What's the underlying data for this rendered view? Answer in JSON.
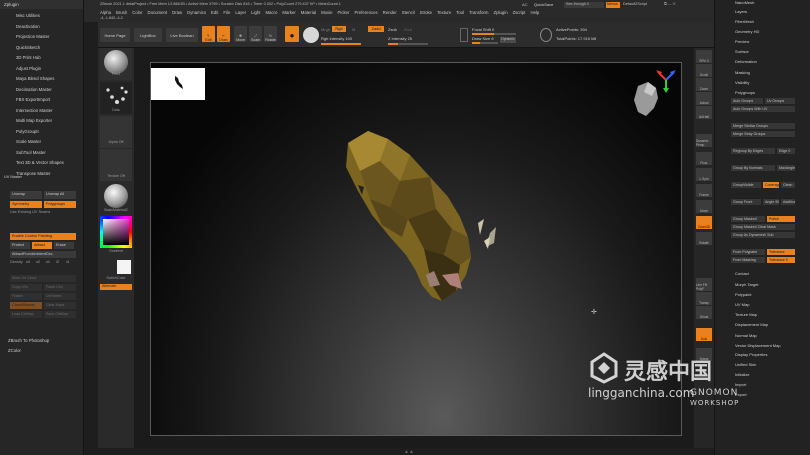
{
  "left_panel": {
    "header": "Zplugin",
    "items": [
      "Misc Utilities",
      "Deactivation",
      "Projection Master",
      "QuickSketch",
      "3D Print Hub",
      "Adjust Plugin",
      "Maya Blend Shapes",
      "Decimation Master",
      "FBX ExportImport",
      "Intersection Master",
      "Multi Map Exporter",
      "PolyGroupIt",
      "Scale Master",
      "SubTool Master",
      "Text 3D & Vector Shapes",
      "Transpose Master"
    ],
    "uv_master": {
      "title": "UV Master",
      "unwrap_label": "Unwrap",
      "unwrap_all_label": "Unwrap All",
      "symmetry_label": "Symmetry",
      "polygroups_label": "Polygroups",
      "use_existing_label": "Use Existing UV Seams",
      "enable_control_painting": "Enable Control Painting",
      "protect_label": "Protect",
      "attract_label": "Attract",
      "erase_label": "Erase",
      "attract_from_ambient": "AttractFromAmbientOcc",
      "density_label": "Density",
      "density_values": [
        "x4",
        "x2",
        "x1",
        "/2",
        "/4"
      ],
      "work_on_clone": "Work On Clone",
      "copy_uvs": "Copy UVs",
      "paste_uvs": "Paste UVs",
      "flatten": "Flatten",
      "unflatten": "UnFlatten",
      "check_seams": "CheckSeams",
      "clear_maps": "Clear Maps",
      "load_ctrl_map": "Load CtrlMap",
      "save_ctrl_map": "Save CtrlMap"
    },
    "bottom_items": [
      "ZBrush To Photoshop",
      "ZColor"
    ]
  },
  "menu_bar": {
    "title": "ZBrush 2021.1 detaiProject  • Free Mem 13.984GB • Active Mem 3799 • Scratch Disk 816 • Timer 0.002 • PolyCount 279.437 KP • MeshCount 1",
    "coords": "-4,-1.842,-4.2",
    "menus": [
      "Alpha",
      "Brush",
      "Color",
      "Document",
      "Draw",
      "Dynamics",
      "Edit",
      "File",
      "Layer",
      "Light",
      "Macro",
      "Marker",
      "Material",
      "Movie",
      "Picker",
      "Preferences",
      "Render",
      "Stencil",
      "Stroke",
      "Texture",
      "Tool",
      "Transform",
      "Zplugin",
      "Zscript",
      "Help"
    ],
    "ac_label": "AC",
    "quicksave_label": "QuickSave",
    "seethrough_label": "See-through 0",
    "menus_button": "Menus",
    "default_zscript": "DefaultZScript"
  },
  "toolbar": {
    "home_page": "Home Page",
    "lightbox": "LightBox",
    "live_boolean": "Live Boolean",
    "edit": "Edit",
    "draw": "Draw",
    "move": "Move",
    "scale": "Scale",
    "rotate": "Rotate",
    "mrgb": "Mrgb",
    "rgb": "Rgb",
    "m": "M",
    "zadd": "Zadd",
    "zsub": "Zsub",
    "zcut": "Zcut",
    "rgb_intensity": "Rgb Intensity 100",
    "z_intensity": "Z Intensity 25",
    "focal_shift": "Focal Shift 0",
    "draw_size": "Draw Size 6",
    "dynamic": "Dynamic",
    "active_points": "ActivePoints: 394",
    "total_points": "TotalPoints: 17.915 Mil"
  },
  "shelf": {
    "tiles": [
      "Pen3",
      "Dots",
      "Alpha Off",
      "Texture Off",
      "BasicMaterial2",
      "Gradient",
      "SwitchColor",
      "Alternate"
    ]
  },
  "right_shelf": {
    "buttons": [
      "SPix 3",
      "Scroll",
      "Zoom",
      "Actual",
      "AAHalf",
      "Dynamic Persp",
      "Floor",
      "L.Sym",
      "Frame",
      "Move",
      "Zoom3D",
      "Rotate",
      "Line Fill PolyF",
      "Transp",
      "Ghost",
      "Solo",
      "Xpose"
    ]
  },
  "right_panel": {
    "top_items": [
      "NanoMesh",
      "Layers",
      "FiberMesh",
      "Geometry HD",
      "Preview",
      "Surface",
      "Deformation",
      "Masking",
      "Visibility",
      "Polygroups"
    ],
    "auto_groups": "Auto Groups",
    "uv_groups": "Uv Groups",
    "auto_groups_with_uv": "Auto Groups With UV",
    "merge_similar": "Merge Similar Groups",
    "merge_stray": "Merge Stray Groups",
    "regroup_by_edges": "Regroup By Edges",
    "edge_val": "Edge 0",
    "group_by_normals": "Group By Normals",
    "max_angle": "MaxAngle",
    "group_visible": "GroupVisible",
    "coverage": "Coverage",
    "clean": "Clean",
    "group_front": "Group Front",
    "angle": "Angle 90",
    "additive": "Additive",
    "group_masked": "Group Masked",
    "polish": "Polish",
    "group_masked_clear": "Group Masked Clear Mask",
    "group_as_dynamesh": "Group As Dynamesh Sub",
    "from_polypaint": "From Polypaint",
    "tolerance": "Tolerance",
    "from_masking": "From Masking",
    "tol_value": "Tolerance 5",
    "bottom_items": [
      "Contact",
      "Morph Target",
      "Polypaint",
      "UV Map",
      "Texture Map",
      "Displacement Map",
      "Normal Map",
      "Vector Displacement Map",
      "Display Properties",
      "Unified Skin",
      "Initialize",
      "Import",
      "Export"
    ]
  },
  "watermark": {
    "brand_cn": "灵感中国",
    "site": "lingganchina.com",
    "brand_gnomon": "GNOMON",
    "brand_workshop": "WORKSHOP"
  },
  "colors": {
    "accent": "#e8821e",
    "panel": "#262626",
    "canvas": "#1b1b1b"
  }
}
